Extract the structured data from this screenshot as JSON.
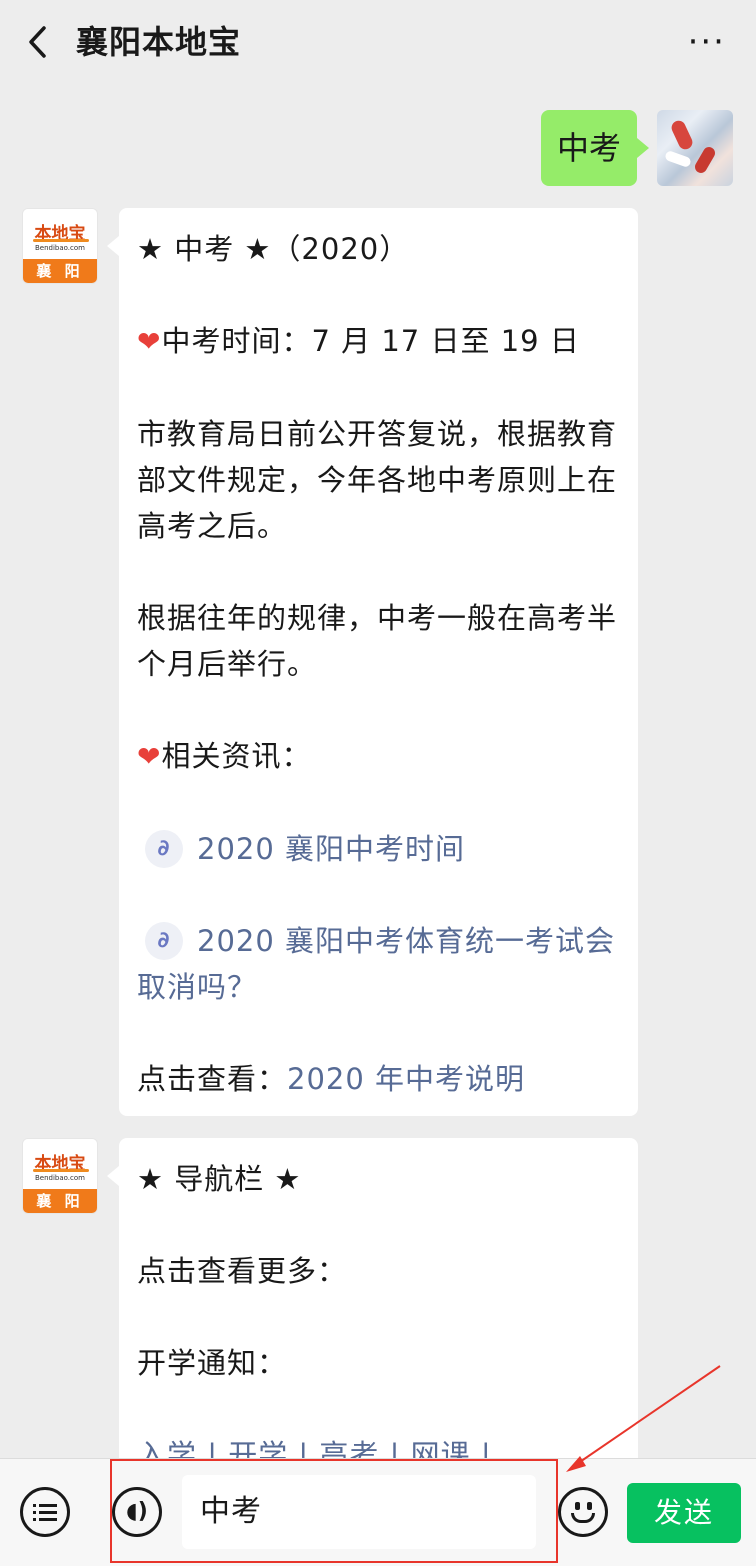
{
  "header": {
    "title": "襄阳本地宝",
    "more_label": "···"
  },
  "outgoing": {
    "text": "中考"
  },
  "bot": {
    "logo_text": "本地宝",
    "domain_text": "Bendibao.com",
    "city_text": "襄 阳"
  },
  "message1": {
    "title": "★ 中考 ★（2020）",
    "heart": "❤",
    "exam_time": "中考时间：7 月 17 日至 19 日",
    "para1": "市教育局日前公开答复说，根据教育部文件规定，今年各地中考原则上在高考之后。",
    "para2": "根据往年的规律，中考一般在高考半个月后举行。",
    "related_label": "相关资讯：",
    "link1": "2020 襄阳中考时间",
    "link2": "2020 襄阳中考体育统一考试会取消吗？",
    "view_label": "点击查看：",
    "view_link": "2020 年中考说明"
  },
  "message2": {
    "title": "★ 导航栏 ★",
    "line1": "点击查看更多：",
    "line2": "开学通知：",
    "links": "入学 | 开学 | 高考 | 网课 |"
  },
  "input": {
    "value": "中考"
  },
  "send_label": "发送"
}
